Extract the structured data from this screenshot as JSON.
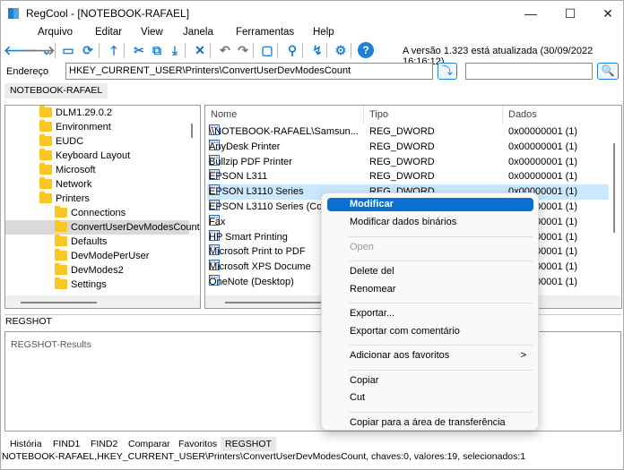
{
  "window": {
    "title": "RegCool - [NOTEBOOK-RAFAEL]",
    "minimize": "—",
    "maximize": "☐",
    "close": "✕"
  },
  "menu": [
    "Arquivo",
    "Editar",
    "View",
    "Janela",
    "Ferramentas",
    "Help"
  ],
  "toolbar": {
    "icons": [
      "arrow-left-icon",
      "arrow-right-icon",
      "chevron-down-icon",
      "computer-icon",
      "refresh-icon",
      "arrow-up-icon",
      "cut-icon",
      "copy-icon",
      "import-icon",
      "delete-icon",
      "undo-icon",
      "redo-icon",
      "new-folder-icon",
      "search-icon",
      "jump-icon",
      "settings-icon",
      "help-icon"
    ],
    "version_text": "A versão 1.323 está atualizada (30/09/2022 16:16:12)"
  },
  "address": {
    "label": "Endereço",
    "value": "HKEY_CURRENT_USER\\Printers\\ConvertUserDevModesCount",
    "search_value": ""
  },
  "computer_tab": "NOTEBOOK-RAFAEL",
  "tree": [
    {
      "label": "DLM1.29.0.2",
      "level": 1
    },
    {
      "label": "Environment",
      "level": 1
    },
    {
      "label": "EUDC",
      "level": 1
    },
    {
      "label": "Keyboard Layout",
      "level": 1
    },
    {
      "label": "Microsoft",
      "level": 1
    },
    {
      "label": "Network",
      "level": 1
    },
    {
      "label": "Printers",
      "level": 1
    },
    {
      "label": "Connections",
      "level": 2
    },
    {
      "label": "ConvertUserDevModesCount",
      "level": 2,
      "selected": true
    },
    {
      "label": "Defaults",
      "level": 2
    },
    {
      "label": "DevModePerUser",
      "level": 2
    },
    {
      "label": "DevModes2",
      "level": 2
    },
    {
      "label": "Settings",
      "level": 2
    }
  ],
  "list": {
    "columns": [
      "Nome",
      "Tipo",
      "Dados"
    ],
    "rows": [
      [
        "\\\\NOTEBOOK-RAFAEL\\Samsun...",
        "REG_DWORD",
        "0x00000001 (1)"
      ],
      [
        "AnyDesk Printer",
        "REG_DWORD",
        "0x00000001 (1)"
      ],
      [
        "Bullzip PDF Printer",
        "REG_DWORD",
        "0x00000001 (1)"
      ],
      [
        "EPSON L311",
        "REG_DWORD",
        "0x00000001 (1)"
      ],
      [
        "EPSON L3110 Series",
        "REG_DWORD",
        "0x00000001 (1)"
      ],
      [
        "EPSON L3110 Series (Co",
        "",
        "0x00000001 (1)"
      ],
      [
        "Fax",
        "",
        "0x00000001 (1)"
      ],
      [
        "HP Smart Printing",
        "",
        "0x00000001 (1)"
      ],
      [
        "Microsoft Print to PDF",
        "",
        "0x00000001 (1)"
      ],
      [
        "Microsoft XPS Docume",
        "",
        "0x00000001 (1)"
      ],
      [
        "OneNote (Desktop)",
        "",
        "0x00000001 (1)"
      ]
    ],
    "selected_index": 4
  },
  "context_menu": [
    {
      "label": "Modificar",
      "highlighted": true
    },
    {
      "label": "Modificar dados binários"
    },
    {
      "sep": true
    },
    {
      "label": "Open",
      "disabled": true
    },
    {
      "sep": true
    },
    {
      "label": "Delete del"
    },
    {
      "label": "Renomear"
    },
    {
      "sep": true
    },
    {
      "label": "Exportar..."
    },
    {
      "label": "Exportar com comentário"
    },
    {
      "sep": true
    },
    {
      "label": "Adicionar aos favoritos",
      "submenu": ">"
    },
    {
      "sep": true
    },
    {
      "label": "Copiar"
    },
    {
      "label": "Cut"
    },
    {
      "sep": true
    },
    {
      "label": "Copiar para a área de transferência"
    }
  ],
  "regshot": {
    "title": "REGSHOT",
    "results": "REGSHOT-Results"
  },
  "bottom_tabs": [
    "História",
    "FIND1",
    "FIND2",
    "Comparar",
    "Favoritos",
    "REGSHOT"
  ],
  "active_bottom_tab": "REGSHOT",
  "status": "NOTEBOOK-RAFAEL,HKEY_CURRENT_USER\\Printers\\ConvertUserDevModesCount, chaves:0, valores:19, selecionados:1",
  "colors": {
    "accent": "#0a6fd1",
    "selection": "#cce8ff",
    "folder": "#f9c623"
  }
}
